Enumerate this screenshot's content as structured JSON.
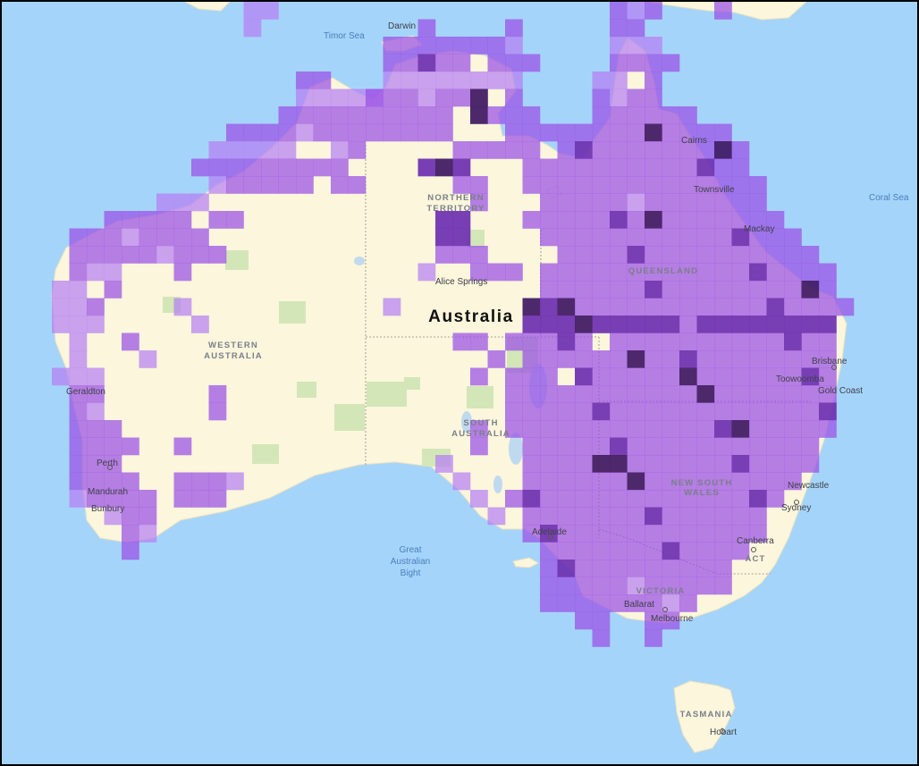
{
  "map": {
    "country_label": "Australia",
    "water": {
      "timor": "Timor Sea",
      "coral": "Coral Sea",
      "bight_1": "Great",
      "bight_2": "Australian",
      "bight_3": "Bight"
    },
    "states": {
      "nt_1": "NORTHERN",
      "nt_2": "TERRITORY",
      "wa_1": "WESTERN",
      "wa_2": "AUSTRALIA",
      "sa_1": "SOUTH",
      "sa_2": "AUSTRALIA",
      "qld": "QUEENSLAND",
      "nsw_1": "NEW SOUTH",
      "nsw_2": "WALES",
      "vic": "VICTORIA",
      "act": "ACT",
      "tas": "TASMANIA"
    },
    "cities": {
      "darwin": "Darwin",
      "cairns": "Cairns",
      "townsville": "Townsville",
      "mackay": "Mackay",
      "alice": "Alice Springs",
      "brisbane": "Brisbane",
      "toowoomba": "Toowoomba",
      "gold_coast": "Gold Coast",
      "geraldton": "Geraldton",
      "perth": "Perth",
      "mandurah": "Mandurah",
      "bunbury": "Bunbury",
      "adelaide": "Adelaide",
      "newcastle": "Newcastle",
      "sydney": "Sydney",
      "canberra": "Canberra",
      "ballarat": "Ballarat",
      "melbourne": "Melbourne",
      "hobart": "Hobart"
    },
    "colors": {
      "ocean": "#a5d4fb",
      "land": "#fbf6dc",
      "grid_light": "#b57ff2",
      "grid_mid": "#9a4fe6",
      "grid_dark": "#6d2fb0",
      "grid_darkest": "#3e1762"
    }
  }
}
